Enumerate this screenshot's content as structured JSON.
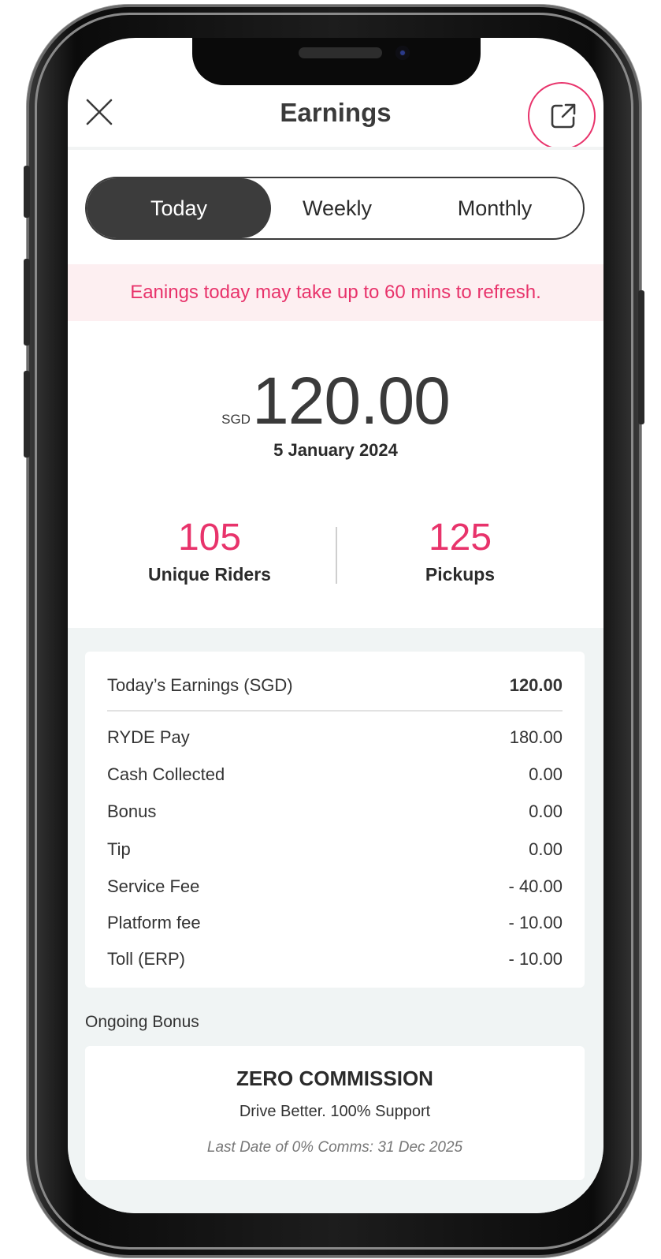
{
  "header": {
    "title": "Earnings",
    "close_icon": "close-icon",
    "share_icon": "external-link-icon"
  },
  "tabs": [
    {
      "label": "Today",
      "active": true
    },
    {
      "label": "Weekly",
      "active": false
    },
    {
      "label": "Monthly",
      "active": false
    }
  ],
  "notice": "Eanings today may take up to 60 mins to refresh.",
  "summary": {
    "currency": "SGD",
    "amount": "120.00",
    "date": "5 January 2024"
  },
  "stats": {
    "riders": {
      "value": "105",
      "label": "Unique Riders"
    },
    "pickups": {
      "value": "125",
      "label": "Pickups"
    }
  },
  "breakdown": {
    "total": {
      "label": "Today’s Earnings (SGD)",
      "value": "120.00"
    },
    "items": [
      {
        "label": "RYDE Pay",
        "value": "180.00"
      },
      {
        "label": "Cash Collected",
        "value": "0.00"
      },
      {
        "label": "Bonus",
        "value": "0.00"
      },
      {
        "label": "Tip",
        "value": "0.00"
      },
      {
        "label": "Service Fee",
        "value": "- 40.00"
      },
      {
        "label": "Platform fee",
        "value": "- 10.00"
      },
      {
        "label": "Toll (ERP)",
        "value": "- 10.00"
      }
    ]
  },
  "ongoing_bonus": {
    "section_label": "Ongoing Bonus",
    "title": "ZERO COMMISSION",
    "subtitle": "Drive Better. 100% Support",
    "note": "Last Date of 0% Comms: 31 Dec 2025"
  },
  "colors": {
    "accent": "#e8336b",
    "active_tab": "#3c3c3c",
    "notice_bg": "#fdeff1",
    "section_bg": "#f0f4f4"
  }
}
